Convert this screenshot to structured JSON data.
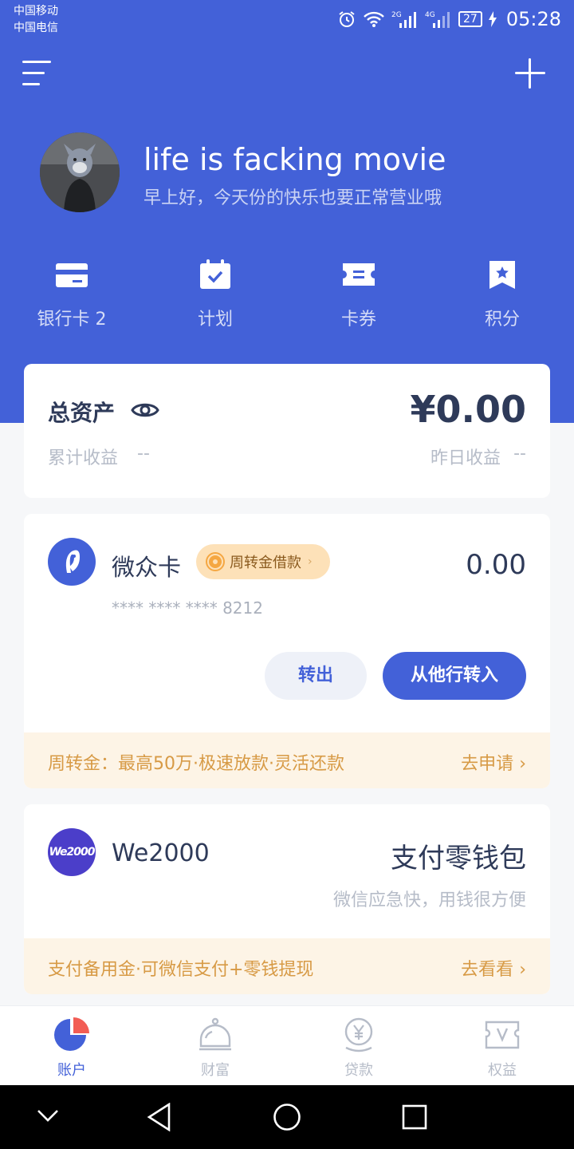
{
  "status_bar": {
    "carrier_1": "中国移动",
    "carrier_2": "中国电信",
    "network_1": "2G",
    "network_2": "4G",
    "battery": "27",
    "time": "05:28"
  },
  "header": {
    "menu_icon": "menu-icon",
    "add_icon": "plus-icon"
  },
  "profile": {
    "username": "life is facking movie",
    "greeting": "早上好，今天份的快乐也要正常营业哦"
  },
  "shortcuts": [
    {
      "icon": "bank-card-icon",
      "label": "银行卡 2"
    },
    {
      "icon": "calendar-check-icon",
      "label": "计划"
    },
    {
      "icon": "ticket-icon",
      "label": "卡券"
    },
    {
      "icon": "bookmark-star-icon",
      "label": "积分"
    }
  ],
  "assets": {
    "title": "总资产",
    "amount": "¥0.00",
    "accumulated_label": "累计收益",
    "accumulated_value": "--",
    "yesterday_label": "昨日收益",
    "yesterday_value": "--"
  },
  "webank_card": {
    "name": "微众卡",
    "tag": "周转金借款",
    "balance": "0.00",
    "number": "**** **** **** 8212",
    "transfer_out": "转出",
    "transfer_in": "从他行转入",
    "promo_text": "周转金：最高50万·极速放款·灵活还款",
    "promo_link": "去申请"
  },
  "we2000": {
    "logo_text": "We2000",
    "name": "We2000",
    "title": "支付零钱包",
    "subtitle": "微信应急快，用钱很方便",
    "promo_text": "支付备用金·可微信支付+零钱提现",
    "promo_link": "去看看"
  },
  "tabs": [
    {
      "icon": "pie-chart-icon",
      "label": "账户",
      "active": true
    },
    {
      "icon": "piggy-bell-icon",
      "label": "财富",
      "active": false
    },
    {
      "icon": "yen-coin-icon",
      "label": "贷款",
      "active": false
    },
    {
      "icon": "vip-ticket-icon",
      "label": "权益",
      "active": false
    }
  ],
  "colors": {
    "brand_blue": "#4361d8",
    "promo_orange": "#d79a45",
    "pie_red": "#f25c54"
  }
}
